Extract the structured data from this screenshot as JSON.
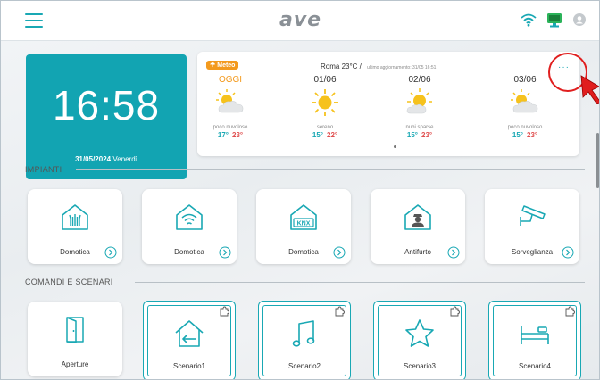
{
  "header": {
    "logo_text": "ave",
    "icons": [
      "menu-icon",
      "wifi-icon",
      "network-device-icon",
      "user-icon"
    ]
  },
  "clock": {
    "time": "16:58",
    "date": "31/05/2024",
    "weekday": "Venerdì"
  },
  "weather": {
    "badge": "Meteo",
    "header": "Roma 23°C  /",
    "updated": "ultimo aggiornamento: 31/05 16:51",
    "more": "···",
    "days": [
      {
        "name": "OGGI",
        "icon": "partly-cloudy-icon",
        "desc": "poco nuvoloso",
        "min": "17°",
        "max": "23°",
        "highlight": true
      },
      {
        "name": "01/06",
        "icon": "sun-icon",
        "desc": "sereno",
        "min": "15°",
        "max": "22°"
      },
      {
        "name": "02/06",
        "icon": "scattered-clouds-icon",
        "desc": "nubi sparse",
        "min": "15°",
        "max": "23°"
      },
      {
        "name": "03/06",
        "icon": "partly-cloudy-icon",
        "desc": "poco nuvoloso",
        "min": "15°",
        "max": "23°"
      }
    ]
  },
  "sections": {
    "impianti": "IMPIANTI",
    "comandi": "COMANDI E SCENARI"
  },
  "impianti": [
    {
      "label": "Domotica",
      "icon": "domotica-icon"
    },
    {
      "label": "Domotica",
      "icon": "wireless-domotica-icon"
    },
    {
      "label": "Domotica",
      "icon": "knx-icon"
    },
    {
      "label": "Antifurto",
      "icon": "antifurto-icon"
    },
    {
      "label": "Sorveglianza",
      "icon": "camera-icon"
    }
  ],
  "knx_text": "KNX",
  "scenari": [
    {
      "label": "Aperture",
      "icon": "door-icon"
    },
    {
      "label": "Scenario1",
      "icon": "home-return-icon"
    },
    {
      "label": "Scenario2",
      "icon": "music-note-icon"
    },
    {
      "label": "Scenario3",
      "icon": "star-icon"
    },
    {
      "label": "Scenario4",
      "icon": "bed-icon"
    }
  ],
  "colors": {
    "accent": "#12a4b2",
    "max_temp": "#e05050",
    "badge": "#f39a1e",
    "annotation": "#e01e1e"
  }
}
